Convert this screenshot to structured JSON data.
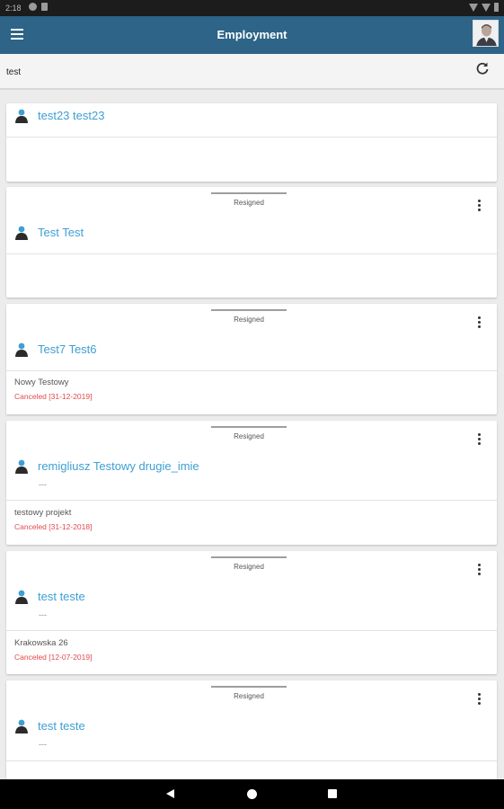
{
  "status_bar": {
    "time": "2:18"
  },
  "app_bar": {
    "title": "Employment"
  },
  "search": {
    "query": "test"
  },
  "cards": [
    {
      "name": "test23 test23"
    },
    {
      "status": "Resigned",
      "name": "Test Test"
    },
    {
      "status": "Resigned",
      "name": "Test7 Test6",
      "project": "Nowy Testowy",
      "cancel": "Canceled [31-12-2019]"
    },
    {
      "status": "Resigned",
      "name": "remigliusz Testowy drugie_imie",
      "sub": "---",
      "project": "testowy projekt",
      "cancel": "Canceled [31-12-2018]"
    },
    {
      "status": "Resigned",
      "name": "test teste",
      "sub": "---",
      "project": "Krakowska 26",
      "cancel": "Canceled [12-07-2019]"
    },
    {
      "status": "Resigned",
      "name": "test teste",
      "sub": "---"
    }
  ],
  "colors": {
    "app_bar": "#2d6487",
    "link": "#3e9fd3",
    "canceled": "#e14b4b",
    "person_head": "#3e9fd3",
    "person_body": "#2b2b2b"
  }
}
